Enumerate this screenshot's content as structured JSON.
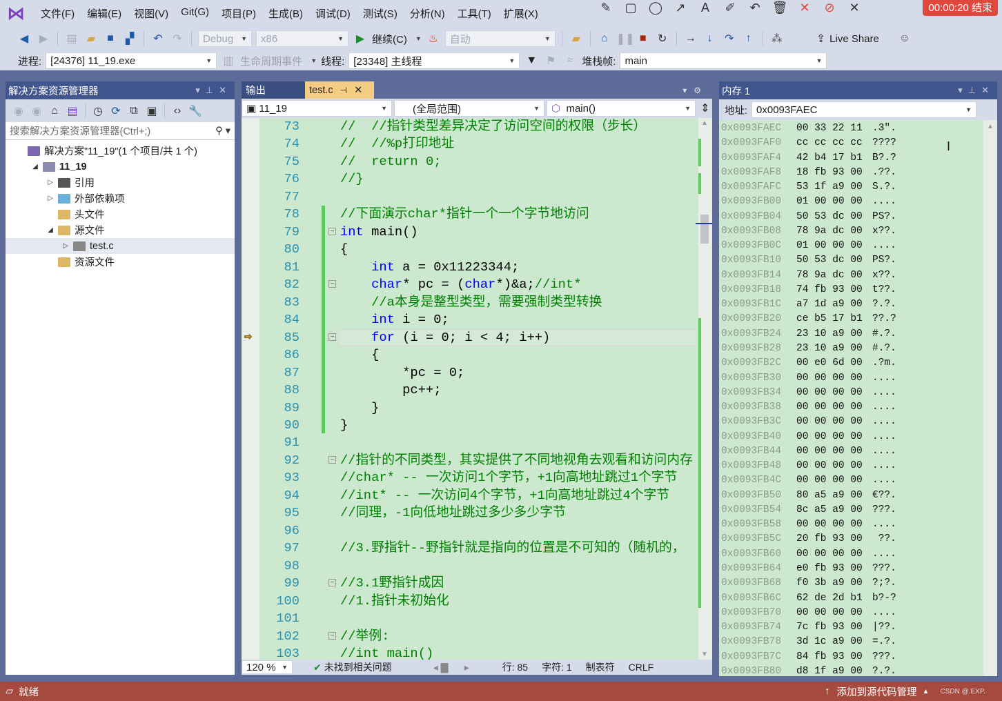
{
  "menubar": {
    "items": [
      "文件(F)",
      "编辑(E)",
      "视图(V)",
      "Git(G)",
      "项目(P)",
      "生成(B)",
      "调试(D)",
      "测试(S)",
      "分析(N)",
      "工具(T)",
      "扩展(X)"
    ]
  },
  "recorder": {
    "timer": "00:00:20 结束"
  },
  "toolbar": {
    "config": "Debug",
    "platform": "x86",
    "continue": "继续(C)",
    "auto": "自动",
    "live_share": "Live Share"
  },
  "debugbar": {
    "process_label": "进程:",
    "process": "[24376] 11_19.exe",
    "lifecycle": "生命周期事件",
    "thread_label": "线程:",
    "thread": "[23348] 主线程",
    "stack_label": "堆栈帧:",
    "stack": "main"
  },
  "solution_explorer": {
    "title": "解决方案资源管理器",
    "search_placeholder": "搜索解决方案资源管理器(Ctrl+;)",
    "tree": [
      {
        "label": "解决方案\"11_19\"(1 个项目/共 1 个)",
        "depth": 0,
        "exp": "",
        "icon": "solution-icon",
        "color": "#7b68ae"
      },
      {
        "label": "11_19",
        "depth": 1,
        "exp": "◢",
        "icon": "project-icon",
        "color": "#8d8ab0",
        "bold": true
      },
      {
        "label": "引用",
        "depth": 2,
        "exp": "▷",
        "icon": "references-icon",
        "color": "#555"
      },
      {
        "label": "外部依赖项",
        "depth": 2,
        "exp": "▷",
        "icon": "external-deps-icon",
        "color": "#6ab0d8"
      },
      {
        "label": "头文件",
        "depth": 2,
        "exp": "",
        "icon": "filter-folder-icon",
        "color": "#dcb866"
      },
      {
        "label": "源文件",
        "depth": 2,
        "exp": "◢",
        "icon": "filter-folder-icon",
        "color": "#dcb866"
      },
      {
        "label": "test.c",
        "depth": 3,
        "exp": "▷",
        "icon": "c-file-icon",
        "color": "#888",
        "selected": true
      },
      {
        "label": "资源文件",
        "depth": 2,
        "exp": "",
        "icon": "filter-folder-icon",
        "color": "#dcb866"
      }
    ]
  },
  "editor": {
    "tabs": [
      {
        "label": "输出"
      },
      {
        "label": "test.c"
      }
    ],
    "nav": {
      "project": "11_19",
      "scope": "(全局范围)",
      "member": "main()"
    },
    "current_line": 85,
    "lines": [
      {
        "n": "73",
        "s": [
          [
            "//  //指针类型差异决定了访问空间的权限（步长）",
            "c"
          ]
        ]
      },
      {
        "n": "74",
        "s": [
          [
            "//  //%p打印地址",
            "c"
          ]
        ]
      },
      {
        "n": "75",
        "s": [
          [
            "//  return 0;",
            "c"
          ]
        ]
      },
      {
        "n": "76",
        "s": [
          [
            "//}",
            "c"
          ]
        ]
      },
      {
        "n": "77",
        "s": []
      },
      {
        "n": "78",
        "s": [
          [
            "//下面演示char*指针一个一个字节地访问",
            "c"
          ]
        ]
      },
      {
        "n": "79",
        "s": [
          [
            "int",
            "k"
          ],
          [
            " main()",
            "t"
          ]
        ]
      },
      {
        "n": "80",
        "s": [
          [
            "{",
            "t"
          ]
        ]
      },
      {
        "n": "81",
        "s": [
          [
            "    ",
            "t"
          ],
          [
            "int",
            "k"
          ],
          [
            " a = 0x11223344;",
            "t"
          ]
        ]
      },
      {
        "n": "82",
        "s": [
          [
            "    ",
            "t"
          ],
          [
            "char",
            "k"
          ],
          [
            "* pc = (",
            "t"
          ],
          [
            "char",
            "k"
          ],
          [
            "*)&a;",
            "t"
          ],
          [
            "//int*",
            "c"
          ]
        ]
      },
      {
        "n": "83",
        "s": [
          [
            "    //a本身是整型类型，需要强制类型转换",
            "c"
          ]
        ]
      },
      {
        "n": "84",
        "s": [
          [
            "    ",
            "t"
          ],
          [
            "int",
            "k"
          ],
          [
            " i = 0;",
            "t"
          ]
        ]
      },
      {
        "n": "85",
        "s": [
          [
            "    ",
            "t"
          ],
          [
            "for",
            "k"
          ],
          [
            " (i = 0; i < 4; i++)",
            "t"
          ]
        ]
      },
      {
        "n": "86",
        "s": [
          [
            "    {",
            "t"
          ]
        ]
      },
      {
        "n": "87",
        "s": [
          [
            "        *pc = 0;",
            "t"
          ]
        ]
      },
      {
        "n": "88",
        "s": [
          [
            "        pc++;",
            "t"
          ]
        ]
      },
      {
        "n": "89",
        "s": [
          [
            "    }",
            "t"
          ]
        ]
      },
      {
        "n": "90",
        "s": [
          [
            "}",
            "t"
          ]
        ]
      },
      {
        "n": "91",
        "s": []
      },
      {
        "n": "92",
        "s": [
          [
            "//指针的不同类型，其实提供了不同地视角去观看和访问内存",
            "c"
          ]
        ]
      },
      {
        "n": "93",
        "s": [
          [
            "//char* -- 一次访问1个字节，+1向高地址跳过1个字节",
            "c"
          ]
        ]
      },
      {
        "n": "94",
        "s": [
          [
            "//int* -- 一次访问4个字节，+1向高地址跳过4个字节",
            "c"
          ]
        ]
      },
      {
        "n": "95",
        "s": [
          [
            "//同理，-1向低地址跳过多少多少字节",
            "c"
          ]
        ]
      },
      {
        "n": "96",
        "s": []
      },
      {
        "n": "97",
        "s": [
          [
            "//3.野指针--野指针就是指向的位置是不可知的（随机的，",
            "c"
          ]
        ]
      },
      {
        "n": "98",
        "s": []
      },
      {
        "n": "99",
        "s": [
          [
            "//3.1野指针成因",
            "c"
          ]
        ]
      },
      {
        "n": "100",
        "s": [
          [
            "//1.指针未初始化",
            "c"
          ]
        ]
      },
      {
        "n": "101",
        "s": []
      },
      {
        "n": "102",
        "s": [
          [
            "//举例:",
            "c"
          ]
        ]
      },
      {
        "n": "103",
        "s": [
          [
            "//int main()",
            "c"
          ]
        ]
      }
    ],
    "status": {
      "zoom": "120 %",
      "issues": "未找到相关问题",
      "line": "行: 85",
      "char": "字符: 1",
      "tabs": "制表符",
      "eol": "CRLF"
    }
  },
  "memory": {
    "title": "内存 1",
    "address_label": "地址:",
    "address": "0x0093FAEC",
    "rows": [
      [
        "0x0093FAEC",
        "00 33 22 11",
        ".3\"."
      ],
      [
        "0x0093FAF0",
        "cc cc cc cc",
        "????"
      ],
      [
        "0x0093FAF4",
        "42 b4 17 b1",
        "B?.?"
      ],
      [
        "0x0093FAF8",
        "18 fb 93 00",
        ".??."
      ],
      [
        "0x0093FAFC",
        "53 1f a9 00",
        "S.?."
      ],
      [
        "0x0093FB00",
        "01 00 00 00",
        "...."
      ],
      [
        "0x0093FB04",
        "50 53 dc 00",
        "PS?."
      ],
      [
        "0x0093FB08",
        "78 9a dc 00",
        "x??."
      ],
      [
        "0x0093FB0C",
        "01 00 00 00",
        "...."
      ],
      [
        "0x0093FB10",
        "50 53 dc 00",
        "PS?."
      ],
      [
        "0x0093FB14",
        "78 9a dc 00",
        "x??."
      ],
      [
        "0x0093FB18",
        "74 fb 93 00",
        "t??."
      ],
      [
        "0x0093FB1C",
        "a7 1d a9 00",
        "?.?."
      ],
      [
        "0x0093FB20",
        "ce b5 17 b1",
        "??.?"
      ],
      [
        "0x0093FB24",
        "23 10 a9 00",
        "#.?."
      ],
      [
        "0x0093FB28",
        "23 10 a9 00",
        "#.?."
      ],
      [
        "0x0093FB2C",
        "00 e0 6d 00",
        ".?m."
      ],
      [
        "0x0093FB30",
        "00 00 00 00",
        "...."
      ],
      [
        "0x0093FB34",
        "00 00 00 00",
        "...."
      ],
      [
        "0x0093FB38",
        "00 00 00 00",
        "...."
      ],
      [
        "0x0093FB3C",
        "00 00 00 00",
        "...."
      ],
      [
        "0x0093FB40",
        "00 00 00 00",
        "...."
      ],
      [
        "0x0093FB44",
        "00 00 00 00",
        "...."
      ],
      [
        "0x0093FB48",
        "00 00 00 00",
        "...."
      ],
      [
        "0x0093FB4C",
        "00 00 00 00",
        "...."
      ],
      [
        "0x0093FB50",
        "80 a5 a9 00",
        "€??."
      ],
      [
        "0x0093FB54",
        "8c a5 a9 00",
        "???."
      ],
      [
        "0x0093FB58",
        "00 00 00 00",
        "...."
      ],
      [
        "0x0093FB5C",
        "20 fb 93 00",
        " ??."
      ],
      [
        "0x0093FB60",
        "00 00 00 00",
        "...."
      ],
      [
        "0x0093FB64",
        "e0 fb 93 00",
        "???."
      ],
      [
        "0x0093FB68",
        "f0 3b a9 00",
        "?;?."
      ],
      [
        "0x0093FB6C",
        "62 de 2d b1",
        "b?-?"
      ],
      [
        "0x0093FB70",
        "00 00 00 00",
        "...."
      ],
      [
        "0x0093FB74",
        "7c fb 93 00",
        "|??."
      ],
      [
        "0x0093FB78",
        "3d 1c a9 00",
        "=.?."
      ],
      [
        "0x0093FB7C",
        "84 fb 93 00",
        "???."
      ],
      [
        "0x0093FB80",
        "d8 1f a9 00",
        "?.?."
      ]
    ]
  },
  "statusbar": {
    "ready": "就绪",
    "source_control": "添加到源代码管理",
    "watermark": "CSDN @.EXP."
  },
  "colors": {
    "status_bar": "#a64a3f",
    "editor_bg": "#cce8cf",
    "panel_header": "#40568d",
    "active_tab": "#f5cc84"
  }
}
